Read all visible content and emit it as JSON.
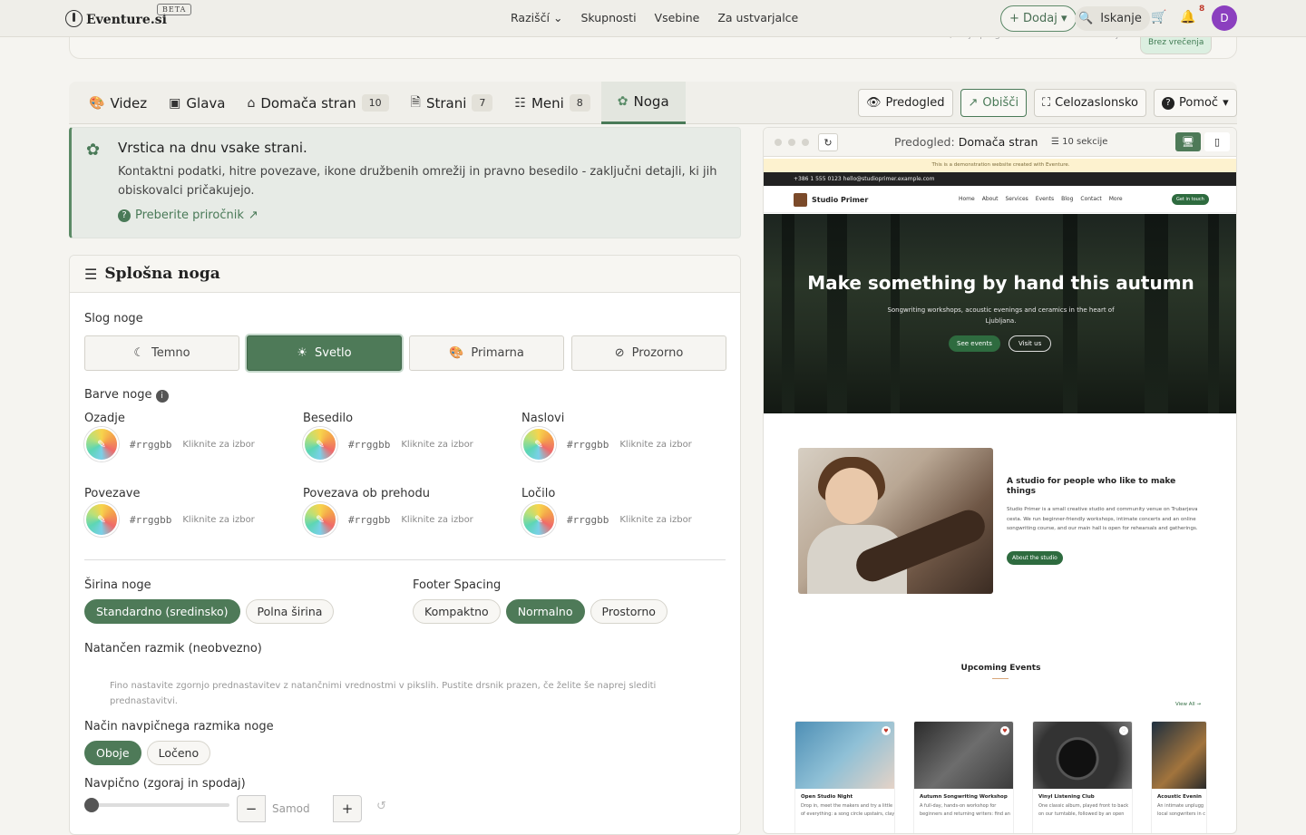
{
  "topbar": {
    "logo_text": "Eventure.si",
    "beta": "BETA",
    "nav": [
      "Raziščí",
      "Skupnosti",
      "Vsebine",
      "Za ustvarjalce"
    ],
    "add_label": "+ Dodaj",
    "search_label": "Iskanje",
    "notifications": "8",
    "avatar_initial": "D"
  },
  "alert_strip": {
    "text": "Vsaka od teh aktivni nove razmecke v dokumentu - aktivira se sele, ko je pregledate in kliknete Aktivnaj.",
    "pill": "Brez vrečenja"
  },
  "tabs": [
    {
      "label": "Videz",
      "icon": "palette-icon",
      "count": ""
    },
    {
      "label": "Glava",
      "icon": "window-icon",
      "count": ""
    },
    {
      "label": "Domača stran",
      "icon": "home-icon",
      "count": "10"
    },
    {
      "label": "Strani",
      "icon": "file-icon",
      "count": "7"
    },
    {
      "label": "Meni",
      "icon": "sitemap-icon",
      "count": "8"
    },
    {
      "label": "Noga",
      "icon": "shoe-prints-icon",
      "count": ""
    }
  ],
  "toolbar": {
    "preview": "Predogled",
    "visit": "Obišči",
    "fullscreen": "Celozaslonsko",
    "help": "Pomoč"
  },
  "help_card": {
    "title": "Vrstica na dnu vsake strani.",
    "description": "Kontaktni podatki, hitre povezave, ikone družbenih omrežij in pravno besedilo - zaključni detajli, ki jih obiskovalci pričakujejo.",
    "link": "Preberite priročnik"
  },
  "panel": {
    "title": "Splošna noga",
    "style_label": "Slog noge",
    "styles": [
      {
        "label": "Temno",
        "active": false
      },
      {
        "label": "Svetlo",
        "active": true
      },
      {
        "label": "Primarna",
        "active": false
      },
      {
        "label": "Prozorno",
        "active": false
      }
    ],
    "colors_label": "Barve noge",
    "colors": [
      {
        "label": "Ozadje",
        "hex": "#rrggbb",
        "pick": "Kliknite za izbor"
      },
      {
        "label": "Besedilo",
        "hex": "#rrggbb",
        "pick": "Kliknite za izbor"
      },
      {
        "label": "Naslovi",
        "hex": "#rrggbb",
        "pick": "Kliknite za izbor"
      },
      {
        "label": "Povezave",
        "hex": "#rrggbb",
        "pick": "Kliknite za izbor"
      },
      {
        "label": "Povezava ob prehodu",
        "hex": "#rrggbb",
        "pick": "Kliknite za izbor"
      },
      {
        "label": "Ločilo",
        "hex": "#rrggbb",
        "pick": "Kliknite za izbor"
      }
    ],
    "width_label": "Širina noge",
    "widths": [
      "Standardno (sredinsko)",
      "Polna širina"
    ],
    "spacing_label": "Footer Spacing",
    "spacings": [
      "Kompaktno",
      "Normalno",
      "Prostorno"
    ],
    "exact_label": "Natančen razmik (neobvezno)",
    "exact_hint": "Fino nastavite zgornjo prednastavitev z natančnimi vrednostmi v pikslih. Pustite drsnik prazen, če želite še naprej slediti prednastavitvi.",
    "vmode_label": "Način navpičnega razmika noge",
    "vmodes": [
      "Oboje",
      "Ločeno"
    ],
    "vertical_label": "Navpično (zgoraj in spodaj)",
    "stepper_placeholder": "Samod"
  },
  "preview": {
    "label": "Predogled:",
    "page": "Domača stran",
    "sections": "10 sekcije",
    "demo_bar": "This is a demonstration website created with Eventure.",
    "contact": "+386 1 555 0123   hello@studioprimer.example.com",
    "brand": "Studio Primer",
    "links": [
      "Home",
      "About",
      "Services",
      "Events",
      "Blog",
      "Contact",
      "More"
    ],
    "cta": "Get in touch",
    "hero_title": "Make something by hand this autumn",
    "hero_text": "Songwriting workshops, acoustic evenings and ceramics in the heart of Ljubljana.",
    "hero_btn1": "See events",
    "hero_btn2": "Visit us",
    "about_title": "A studio for people who like to make things",
    "about_text": "Studio Primer is a small creative studio and community venue on Trubarjeva cesta. We run beginner-friendly workshops, intimate concerts and an online songwriting course, and our main hall is open for rehearsals and gatherings.",
    "about_btn": "About the studio",
    "events_title": "Upcoming Events",
    "view_all": "View All",
    "events": [
      {
        "title": "Open Studio Night",
        "desc": "Drop in, meet the makers and try a little of everything: a song circle upstairs, clay"
      },
      {
        "title": "Autumn Songwriting Workshop",
        "desc": "A full-day, hands-on workshop for beginners and returning writers: find an"
      },
      {
        "title": "Vinyl Listening Club",
        "desc": "One classic album, played front to back on our turntable, followed by an open"
      },
      {
        "title": "Acoustic Evenin",
        "desc": "An intimate unplugg local songwriters in c"
      }
    ]
  }
}
